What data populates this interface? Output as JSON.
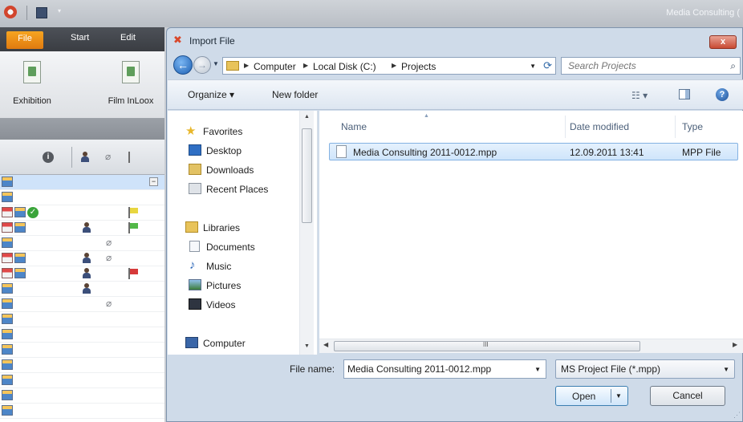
{
  "app": {
    "title": "Media Consulting (",
    "tabs": [
      "File",
      "Start",
      "Edit"
    ],
    "ribbon_buttons": [
      "Exhibition",
      "Film InLoox"
    ]
  },
  "dialog": {
    "title": "Import File",
    "close_label": "x",
    "address": {
      "segments": [
        "Computer",
        "Local Disk (C:)",
        "Projects"
      ]
    },
    "search": {
      "placeholder": "Search Projects"
    },
    "toolbar": {
      "organize": "Organize ▾",
      "new_folder": "New folder"
    },
    "nav": {
      "favorites": {
        "label": "Favorites",
        "items": [
          "Desktop",
          "Downloads",
          "Recent Places"
        ]
      },
      "libraries": {
        "label": "Libraries",
        "items": [
          "Documents",
          "Music",
          "Pictures",
          "Videos"
        ]
      },
      "computer": "Computer"
    },
    "file_list": {
      "columns": [
        "Name",
        "Date modified",
        "Type"
      ],
      "rows": [
        {
          "name": "Media Consulting 2011-0012.mpp",
          "date": "12.09.2011 13:41",
          "type": "MPP File",
          "selected": true
        }
      ]
    },
    "scroll_grip": "III",
    "filename": {
      "label": "File name:",
      "value": "Media Consulting 2011-0012.mpp"
    },
    "filetype": {
      "value": "MS Project File (*.mpp)"
    },
    "buttons": {
      "open": "Open",
      "cancel": "Cancel"
    }
  },
  "colors": {
    "file_tab": "#f0901a",
    "selection": "#cfe5fb",
    "dialog_frame": "#cfdbe9",
    "close_button": "#c84a33"
  }
}
